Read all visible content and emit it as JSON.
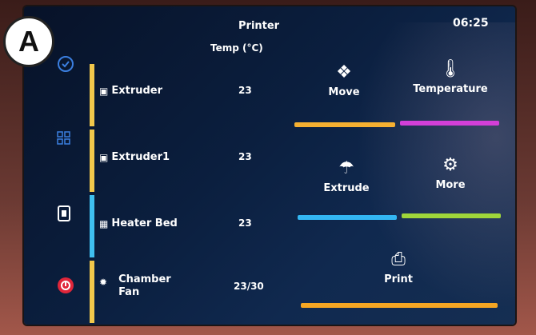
{
  "badge": {
    "letter": "A"
  },
  "header": {
    "title": "Printer",
    "subtitle": "Temp (°C)",
    "time": "06:25"
  },
  "sidebar": {
    "icons": [
      "home-icon",
      "grid-icon",
      "file-icon",
      "emergency-stop-icon"
    ]
  },
  "rows": [
    {
      "label": "Extruder",
      "value": "23",
      "color": "#f2c84b"
    },
    {
      "label": "Extruder1",
      "value": "23",
      "color": "#f2c84b"
    },
    {
      "label": "Heater Bed",
      "value": "23",
      "color": "#3fc0f0"
    },
    {
      "label": "Chamber Fan",
      "label_line1": "Chamber",
      "label_line2": "Fan",
      "value": "23/30",
      "color": "#f2c84b"
    }
  ],
  "actions": {
    "move": {
      "label": "Move",
      "color": "#f5b031"
    },
    "temperature": {
      "label": "Temperature",
      "color": "#d23fd8"
    },
    "extrude": {
      "label": "Extrude",
      "color": "#33b6f2"
    },
    "more": {
      "label": "More",
      "color": "#9fd63a"
    },
    "print": {
      "label": "Print",
      "color": "#f5a623"
    }
  }
}
